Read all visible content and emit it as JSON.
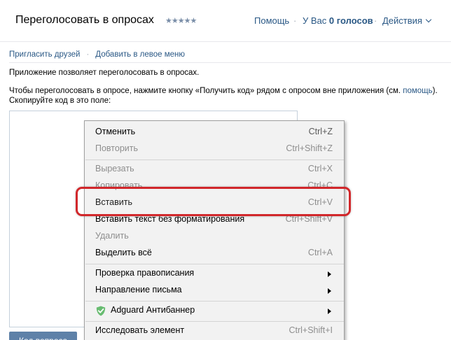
{
  "header": {
    "title": "Переголосовать в опросах",
    "rating": "★★★★★",
    "help": "Помощь",
    "votes_prefix": "У Вас",
    "votes_count": "0 голосов",
    "actions": "Действия"
  },
  "links": {
    "invite": "Пригласить друзей",
    "separator": "·",
    "add_menu": "Добавить в левое меню"
  },
  "content": {
    "intro": "Приложение позволяет переголосовать в опросах.",
    "instruction_before": "Чтобы переголосовать в опросе, нажмите кнопку «Получить код» рядом с опросом вне приложения (см. ",
    "instruction_link": "помощь",
    "instruction_after": ").",
    "instruction_line2": "Скопируйте код в это поле:",
    "button_label": "Код вопроса"
  },
  "context_menu": {
    "undo": {
      "label": "Отменить",
      "shortcut": "Ctrl+Z"
    },
    "redo": {
      "label": "Повторить",
      "shortcut": "Ctrl+Shift+Z"
    },
    "cut": {
      "label": "Вырезать",
      "shortcut": "Ctrl+X"
    },
    "copy": {
      "label": "Копировать",
      "shortcut": "Ctrl+C"
    },
    "paste": {
      "label": "Вставить",
      "shortcut": "Ctrl+V"
    },
    "paste_plain": {
      "label": "Вставить текст без форматирования",
      "shortcut": "Ctrl+Shift+V"
    },
    "delete": {
      "label": "Удалить"
    },
    "select_all": {
      "label": "Выделить всё",
      "shortcut": "Ctrl+A"
    },
    "spellcheck": {
      "label": "Проверка правописания"
    },
    "writing_direction": {
      "label": "Направление письма"
    },
    "adguard": {
      "label": "Adguard Антибаннер",
      "icon": "adguard-shield-icon",
      "color": "#68bc71"
    },
    "inspect": {
      "label": "Исследовать элемент",
      "shortcut": "Ctrl+Shift+I"
    }
  },
  "colors": {
    "link": "#2a5885",
    "highlight": "#d1272b",
    "button": "#5e81a8"
  }
}
